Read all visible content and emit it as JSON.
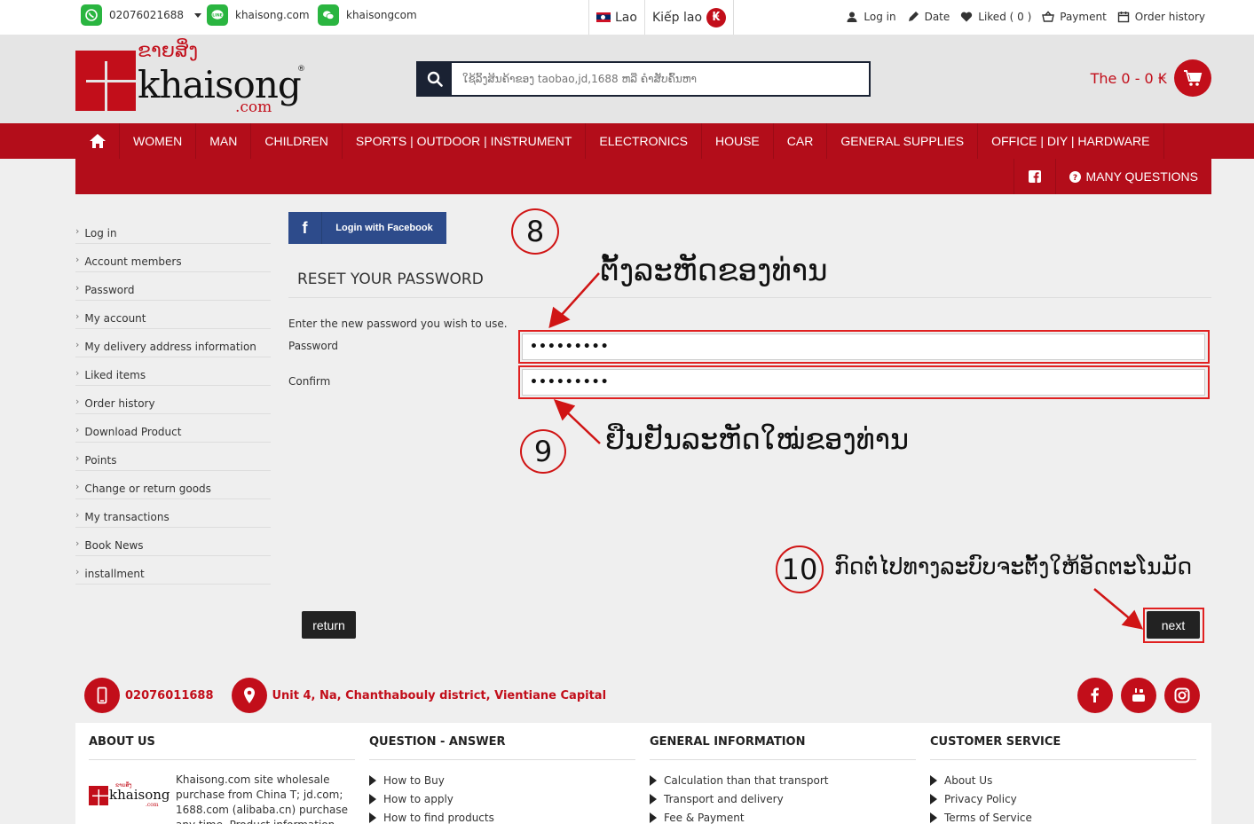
{
  "topbar": {
    "phone": "02076021688",
    "line_id": "khaisong.com",
    "wechat_id": "khaisongcom",
    "lang": "Lao",
    "currency": "Kiếp lao",
    "currency_symbol": "₭",
    "links": {
      "login": "Log in",
      "date": "Date",
      "liked": "Liked ( 0 )",
      "payment": "Payment",
      "order_history": "Order history"
    }
  },
  "header": {
    "logo_lao": "ຂາຍສິ່ງ",
    "logo_text": "khaisong",
    "logo_com": ".com",
    "logo_reg": "®",
    "search_placeholder": "ໃຊ້ລິ້ງສິນຄ້າຂອງ taobao,jd,1688 ຫລື ຄໍາສັບຄົ້ນຫາ",
    "cart_text": "The 0 - 0 ₭"
  },
  "nav": {
    "items": [
      "WOMEN",
      "MAN",
      "CHILDREN",
      "SPORTS | OUTDOOR | INSTRUMENT",
      "ELECTRONICS",
      "HOUSE",
      "CAR",
      "GENERAL SUPPLIES",
      "OFFICE | DIY | HARDWARE"
    ],
    "many_questions": "MANY QUESTIONS"
  },
  "sidebar": {
    "items": [
      "Log in",
      "Account members",
      "Password",
      "My account",
      "My delivery address information",
      "Liked items",
      "Order history",
      "Download Product",
      "Points",
      "Change or return goods",
      "My transactions",
      "Book News",
      "installment"
    ]
  },
  "form": {
    "facebook_login": "Login with Facebook",
    "facebook_glyph": "f",
    "title": "RESET YOUR PASSWORD",
    "instruction": "Enter the new password you wish to use.",
    "password_label": "Password",
    "password_value": "•••••••••",
    "confirm_label": "Confirm",
    "confirm_value": "•••••••••",
    "return_label": "return",
    "next_label": "next"
  },
  "annotations": {
    "step8_num": "8",
    "step8_text": "ຕັ້ງລະຫັດຂອງທ່ານ",
    "step9_num": "9",
    "step9_text": "ຢືນຢັນລະຫັດໃໝ່ຂອງທ່ານ",
    "step10_num": "10",
    "step10_text": "ກົດຕໍ່ໄປທາງລະບົບຈະຕັ້ງໃຫ້ອັດຕະໂນມັດ",
    "color": "#d01515"
  },
  "contact": {
    "phone": "02076011688",
    "address": "Unit 4, Na, Chanthabouly district, Vientiane Capital"
  },
  "footer": {
    "about": {
      "title": "ABOUT US",
      "logo_lao": "ຂາຍສິ່ງ",
      "logo_text": "khaisong",
      "logo_com": ".com",
      "text": "Khaisong.com site wholesale purchase from China T; jd.com; 1688.com (alibaba.cn) purchase any time. Product information from taobao.com link"
    },
    "qa": {
      "title": "QUESTION - ANSWER",
      "links": [
        "How to Buy",
        "How to apply",
        "How to find products"
      ]
    },
    "general": {
      "title": "GENERAL INFORMATION",
      "links": [
        "Calculation than that transport",
        "Transport and delivery",
        "Fee & Payment"
      ]
    },
    "service": {
      "title": "CUSTOMER SERVICE",
      "links": [
        "About Us",
        "Privacy Policy",
        "Terms of Service"
      ]
    }
  },
  "colors": {
    "brand_red": "#c20e1a",
    "nav_red": "#b30d1a",
    "dark": "#1a2233",
    "facebook": "#2d4b8b"
  }
}
